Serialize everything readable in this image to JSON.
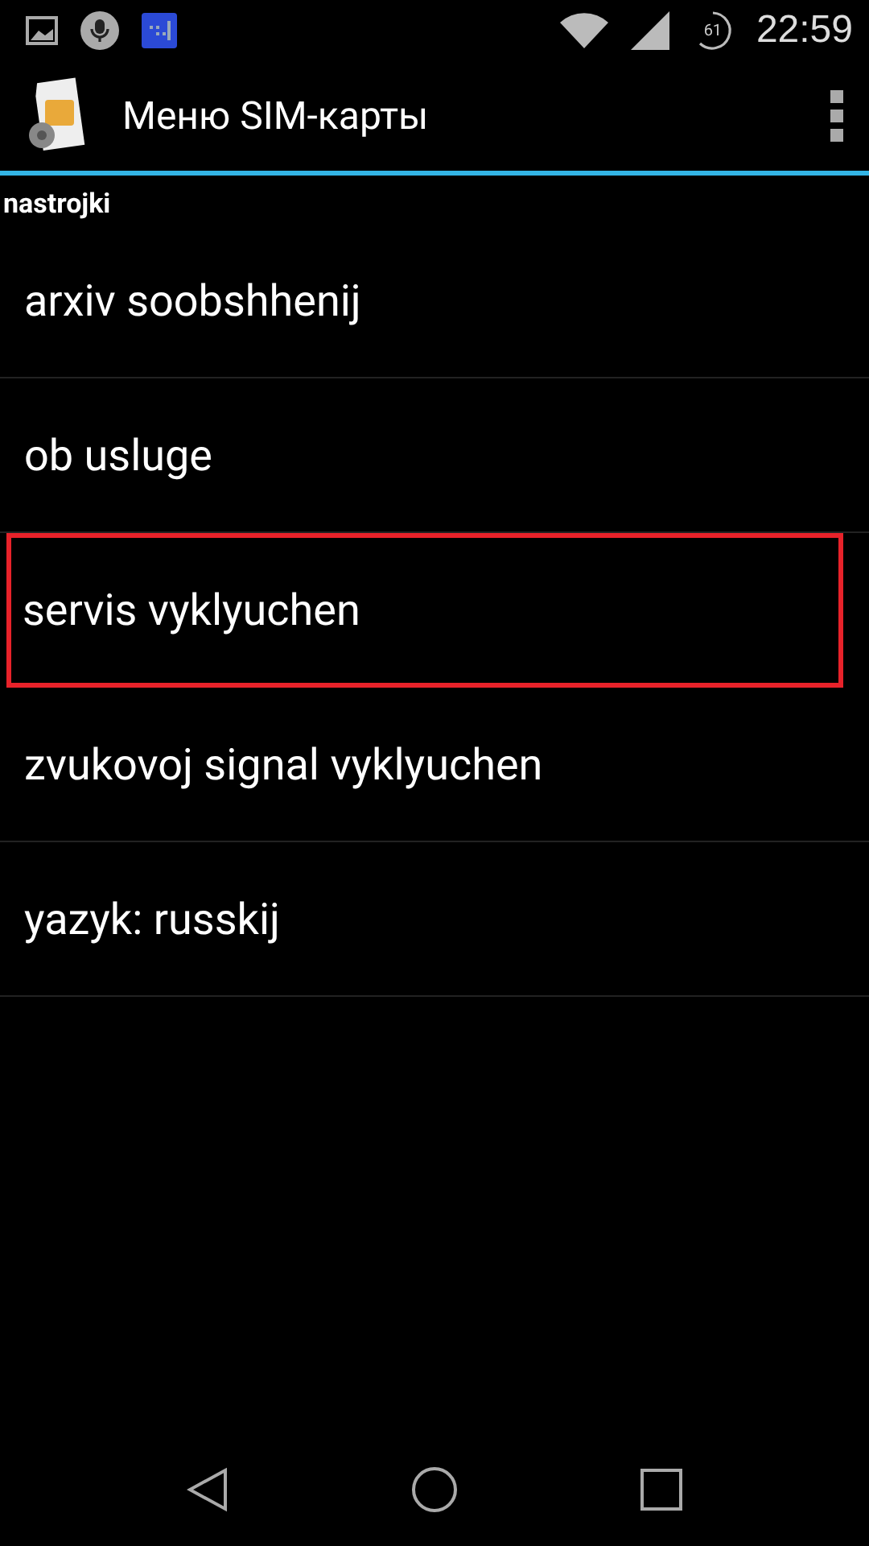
{
  "status_bar": {
    "battery": "61",
    "time": "22:59"
  },
  "action_bar": {
    "title": "Меню SIM-карты"
  },
  "section": {
    "title": "nastrojki"
  },
  "items": [
    {
      "label": "arxiv soobshhenij",
      "highlighted": false
    },
    {
      "label": "ob usluge",
      "highlighted": false
    },
    {
      "label": "servis vyklyuchen",
      "highlighted": true
    },
    {
      "label": "zvukovoj signal vyklyuchen",
      "highlighted": false
    },
    {
      "label": "yazyk: russkij",
      "highlighted": false
    }
  ]
}
